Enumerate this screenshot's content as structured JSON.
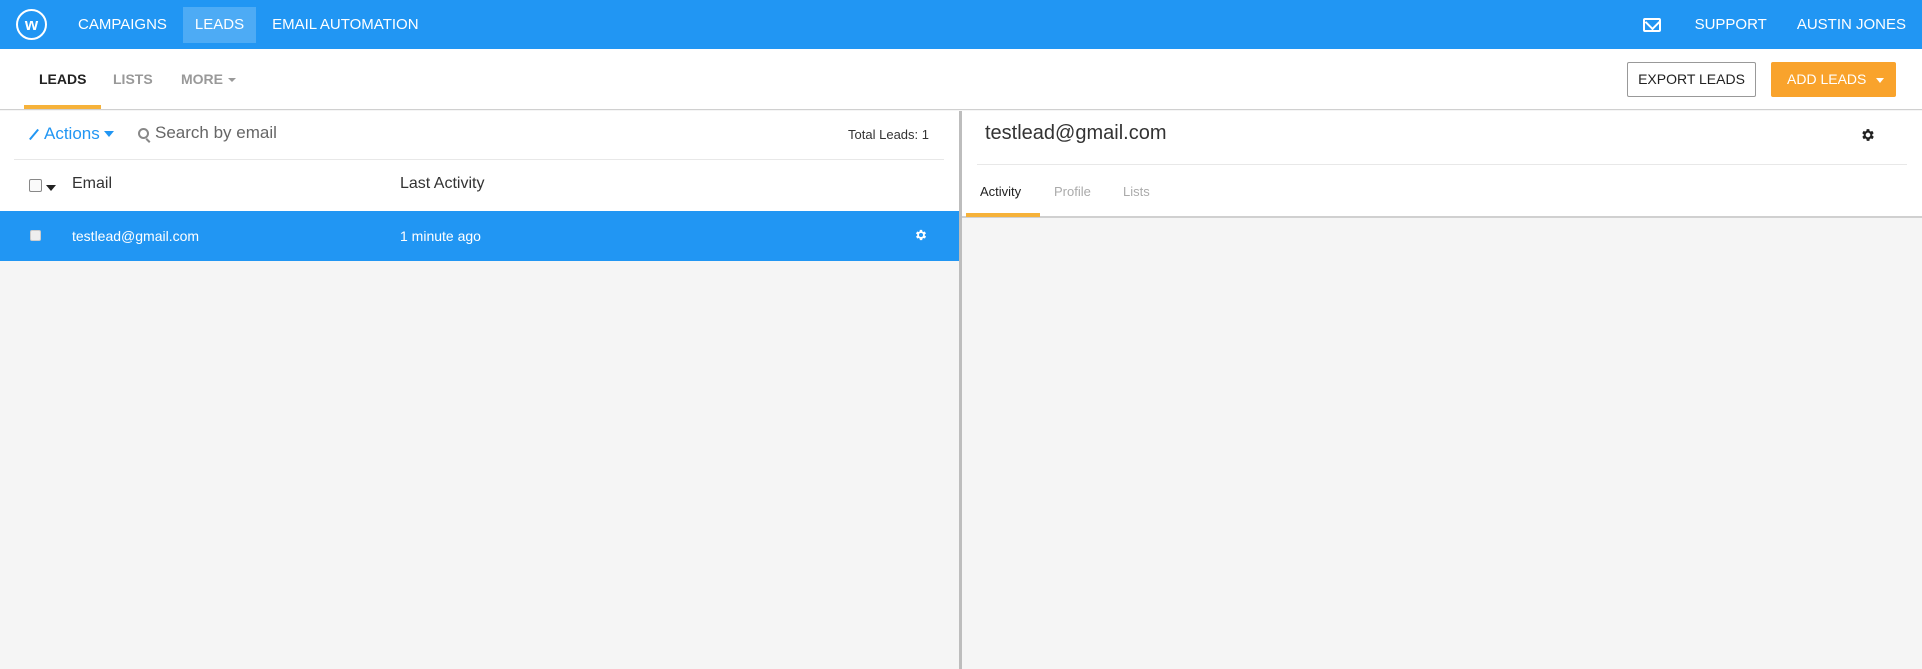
{
  "app": {
    "logo_letter": "w",
    "nav": [
      {
        "label": "CAMPAIGNS",
        "active": false
      },
      {
        "label": "LEADS",
        "active": true
      },
      {
        "label": "EMAIL AUTOMATION",
        "active": false
      }
    ],
    "support_label": "SUPPORT",
    "user_name": "AUSTIN JONES",
    "brand_color": "#2196f3",
    "accent_color": "#f9a32c"
  },
  "subnav": {
    "tabs": [
      "LEADS",
      "LISTS",
      "MORE"
    ],
    "active_tab": "LEADS",
    "export_label": "EXPORT LEADS",
    "add_label": "ADD LEADS"
  },
  "leads_list": {
    "actions_label": "Actions",
    "search_placeholder": "Search by email",
    "total_label": "Total Leads: 1",
    "columns": [
      "Email",
      "Last Activity"
    ],
    "rows": [
      {
        "email": "testlead@gmail.com",
        "last_activity": "1 minute ago",
        "selected": true
      }
    ]
  },
  "lead_detail": {
    "email": "testlead@gmail.com",
    "tabs": [
      "Activity",
      "Profile",
      "Lists"
    ],
    "active_tab": "Activity"
  }
}
